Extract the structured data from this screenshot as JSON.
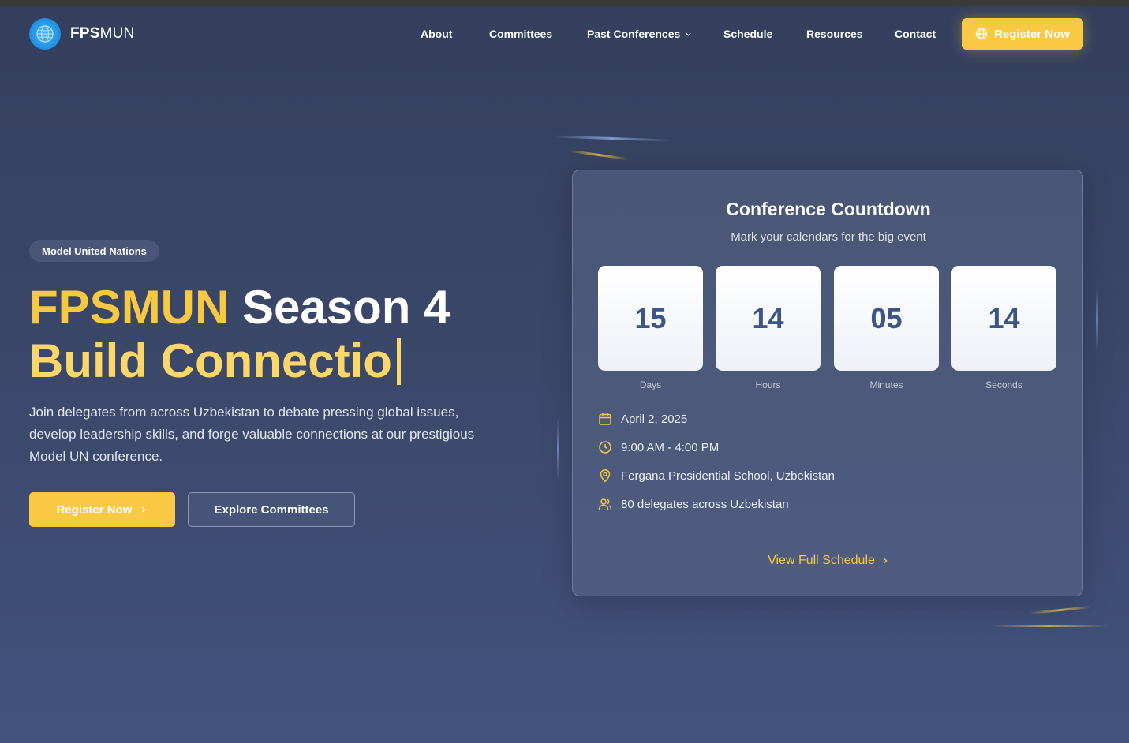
{
  "brand": {
    "bold": "FPS",
    "light": "MUN"
  },
  "nav": {
    "links": [
      {
        "label": "About"
      },
      {
        "label": "Committees"
      },
      {
        "label": "Past Conferences",
        "dropdown": true
      },
      {
        "label": "Schedule"
      },
      {
        "label": "Resources"
      },
      {
        "label": "Contact"
      }
    ],
    "register_label": "Register Now"
  },
  "hero": {
    "badge": "Model United Nations",
    "title_highlight": "FPSMUN",
    "title_rest": "Season 4",
    "title_line2": "Build Connectio",
    "description": "Join delegates from across Uzbekistan to debate pressing global issues, develop leadership skills, and forge valuable connections at our prestigious Model UN conference.",
    "primary_button": "Register Now",
    "secondary_button": "Explore Committees"
  },
  "countdown": {
    "title": "Conference Countdown",
    "subtitle": "Mark your calendars for the big event",
    "units": [
      {
        "value": "15",
        "label": "Days"
      },
      {
        "value": "14",
        "label": "Hours"
      },
      {
        "value": "05",
        "label": "Minutes"
      },
      {
        "value": "14",
        "label": "Seconds"
      }
    ],
    "details": [
      {
        "icon": "calendar-icon",
        "text": "April 2, 2025"
      },
      {
        "icon": "clock-icon",
        "text": "9:00 AM - 4:00 PM"
      },
      {
        "icon": "location-pin-icon",
        "text": "Fergana Presidential School, Uzbekistan"
      },
      {
        "icon": "users-icon",
        "text": "80 delegates across Uzbekistan"
      }
    ],
    "schedule_link": "View Full Schedule"
  },
  "colors": {
    "accent": "#f9c944",
    "tile_number": "#3b5588",
    "background": "#3a4768"
  }
}
